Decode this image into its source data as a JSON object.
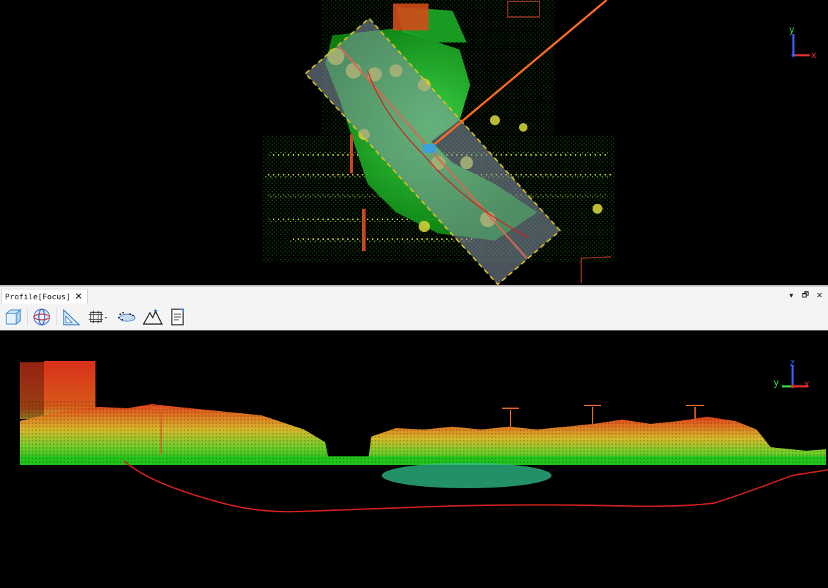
{
  "top_view": {
    "axis_labels": {
      "y": "y",
      "x": "x"
    }
  },
  "panel": {
    "tab_title": "Profile[Focus]",
    "tab_close_glyph": "✕",
    "controls": {
      "dropdown_glyph": "▾",
      "restore_glyph": "🗗",
      "close_glyph": "✕"
    }
  },
  "toolbar": {
    "buttons": [
      {
        "name": "view-cube-icon"
      },
      {
        "name": "orbit-icon"
      },
      {
        "name": "measure-ruler-icon"
      },
      {
        "name": "grid-select-icon"
      },
      {
        "name": "point-display-icon"
      },
      {
        "name": "terrain-profile-icon"
      },
      {
        "name": "report-icon"
      }
    ]
  },
  "profile_view": {
    "axis_labels": {
      "z": "z",
      "y": "y",
      "x": "x"
    }
  },
  "colors": {
    "background": "#000000",
    "point_low": "#22c31a",
    "point_mid": "#d6d62a",
    "point_high": "#e2401a",
    "profile_line": "#d3201d",
    "selection_border": "#e0c020",
    "section_line": "#ff6a20"
  }
}
